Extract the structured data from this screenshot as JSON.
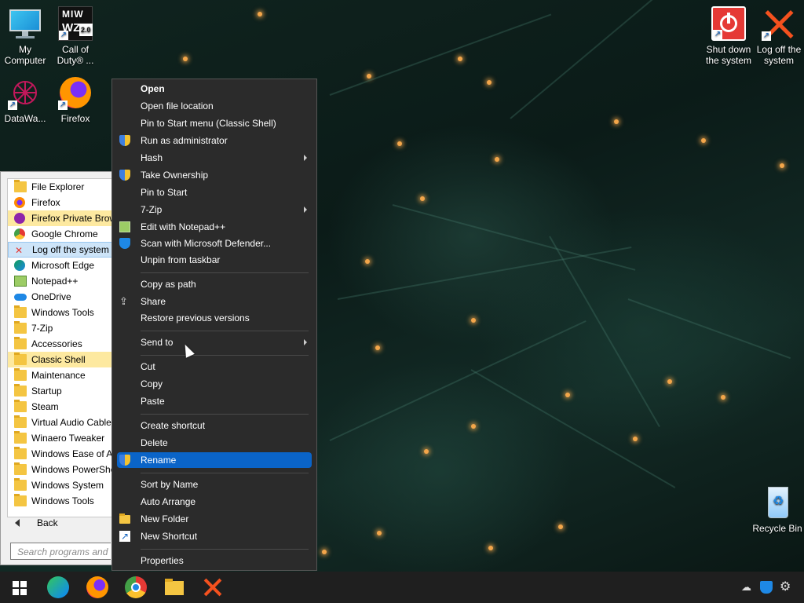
{
  "desktop": {
    "icons": [
      {
        "label": "My Computer",
        "icon": "monitor-icon"
      },
      {
        "label": "Call of Duty® ...",
        "icon": "call-of-duty-icon"
      },
      {
        "label": "DataWa...",
        "icon": "datawa-icon"
      },
      {
        "label": "Firefox",
        "icon": "firefox-icon"
      },
      {
        "label": "Shut down the system",
        "icon": "power-icon"
      },
      {
        "label": "Log off the system",
        "icon": "logoff-x-icon"
      },
      {
        "label": "Recycle Bin",
        "icon": "recycle-bin-icon"
      }
    ],
    "cod_logo_line1": "MIW",
    "cod_logo_line2": "WZ",
    "cod_logo_badge": "2.0"
  },
  "start_menu": {
    "items": [
      {
        "label": "File Explorer",
        "icon": "folder-icon"
      },
      {
        "label": "Firefox",
        "icon": "firefox-icon"
      },
      {
        "label": "Firefox Private Brow",
        "icon": "firefox-private-icon"
      },
      {
        "label": "Google Chrome",
        "icon": "chrome-icon"
      },
      {
        "label": "Log off the system",
        "icon": "logoff-x-icon"
      },
      {
        "label": "Microsoft Edge",
        "icon": "edge-icon"
      },
      {
        "label": "Notepad++",
        "icon": "notepad-icon"
      },
      {
        "label": "OneDrive",
        "icon": "onedrive-icon"
      },
      {
        "label": "Windows Tools",
        "icon": "folder-icon"
      },
      {
        "label": "7-Zip",
        "icon": "folder-icon"
      },
      {
        "label": "Accessories",
        "icon": "folder-icon"
      },
      {
        "label": "Classic Shell",
        "icon": "folder-icon"
      },
      {
        "label": "Maintenance",
        "icon": "folder-icon"
      },
      {
        "label": "Startup",
        "icon": "folder-icon"
      },
      {
        "label": "Steam",
        "icon": "folder-icon"
      },
      {
        "label": "Virtual Audio Cable",
        "icon": "folder-icon"
      },
      {
        "label": "Winaero Tweaker",
        "icon": "folder-icon"
      },
      {
        "label": "Windows Ease of Ac",
        "icon": "folder-icon"
      },
      {
        "label": "Windows PowerShe",
        "icon": "folder-icon"
      },
      {
        "label": "Windows System",
        "icon": "folder-icon"
      },
      {
        "label": "Windows Tools",
        "icon": "folder-icon"
      }
    ],
    "back_label": "Back",
    "search_placeholder": "Search programs and f"
  },
  "context_menu": {
    "items": [
      {
        "label": "Open"
      },
      {
        "label": "Open file location"
      },
      {
        "label": "Pin to Start menu (Classic Shell)"
      },
      {
        "label": "Run as administrator"
      },
      {
        "label": "Hash"
      },
      {
        "label": "Take Ownership"
      },
      {
        "label": "Pin to Start"
      },
      {
        "label": "7-Zip"
      },
      {
        "label": "Edit with Notepad++"
      },
      {
        "label": "Scan with Microsoft Defender..."
      },
      {
        "label": "Unpin from taskbar"
      },
      {
        "label": "Copy as path"
      },
      {
        "label": "Share"
      },
      {
        "label": "Restore previous versions"
      },
      {
        "label": "Send to"
      },
      {
        "label": "Cut"
      },
      {
        "label": "Copy"
      },
      {
        "label": "Paste"
      },
      {
        "label": "Create shortcut"
      },
      {
        "label": "Delete"
      },
      {
        "label": "Rename"
      },
      {
        "label": "Sort by Name"
      },
      {
        "label": "Auto Arrange"
      },
      {
        "label": "New Folder"
      },
      {
        "label": "New Shortcut"
      },
      {
        "label": "Properties"
      }
    ]
  },
  "taskbar": {
    "apps": [
      "windows-start-icon",
      "edge-icon",
      "firefox-icon",
      "chrome-icon",
      "file-explorer-icon",
      "logoff-x-icon"
    ],
    "tray": [
      "network-disconnected-icon",
      "security-shield-icon",
      "settings-gear-icon"
    ]
  },
  "colors": {
    "selection": "#0a64c8",
    "menu_bg": "#2b2b2b",
    "highlight_yellow": "#fde9a0",
    "taskbar": "#1f1f1f"
  }
}
